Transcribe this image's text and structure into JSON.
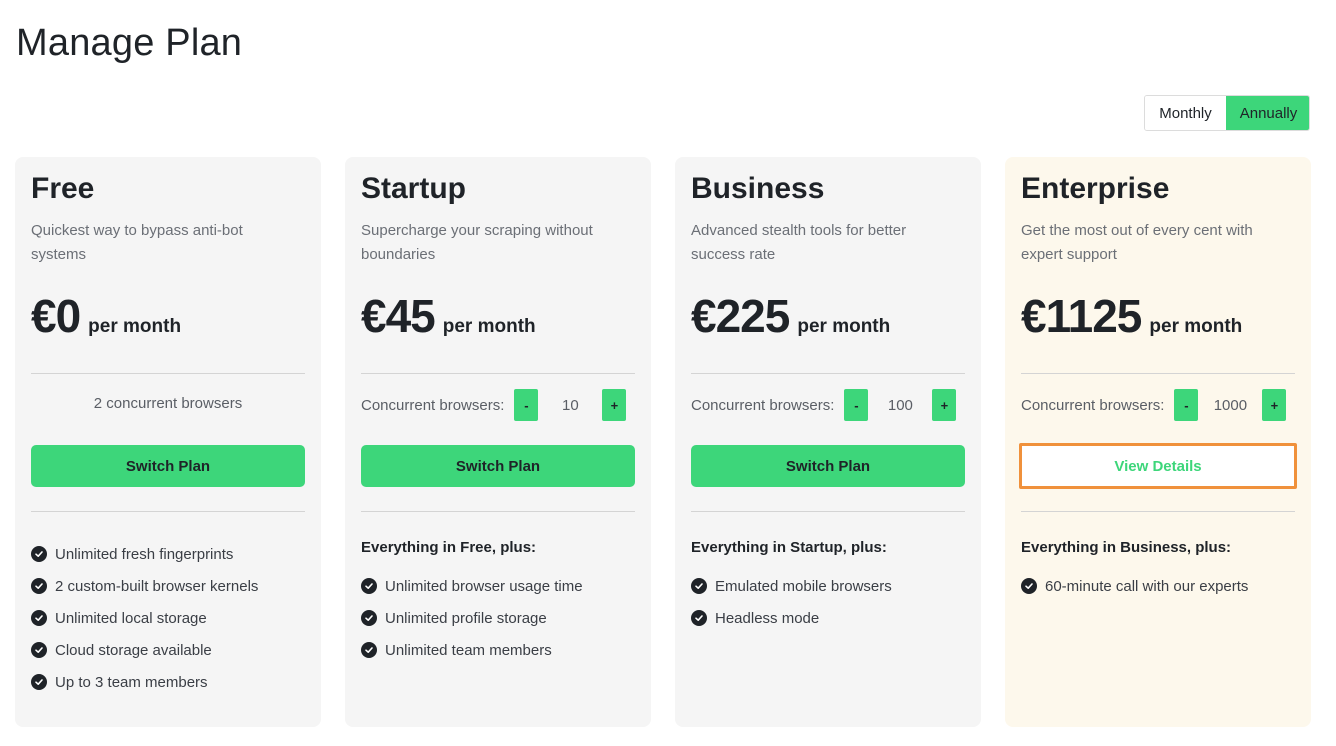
{
  "page_title": "Manage Plan",
  "billing_toggle": {
    "monthly": "Monthly",
    "annually": "Annually",
    "selected": "Annually"
  },
  "colors": {
    "accent": "#3dd67a",
    "highlight_border": "#f0913b",
    "enterprise_bg": "#fdf8ec",
    "card_bg": "#f5f5f5"
  },
  "plans": [
    {
      "name": "Free",
      "description": "Quickest way to bypass anti-bot systems",
      "price": "€0",
      "period": "per month",
      "browsers_text": "2 concurrent browsers",
      "action": "Switch Plan",
      "features": [
        "Unlimited fresh fingerprints",
        "2 custom-built browser kernels",
        "Unlimited local storage",
        "Cloud storage available",
        "Up to 3 team members"
      ]
    },
    {
      "name": "Startup",
      "description": "Supercharge your scraping without boundaries",
      "price": "€45",
      "period": "per month",
      "browsers_label": "Concurrent browsers:",
      "browsers_value": "10",
      "action": "Switch Plan",
      "features_heading": "Everything in Free, plus:",
      "features": [
        "Unlimited browser usage time",
        "Unlimited profile storage",
        "Unlimited team members"
      ]
    },
    {
      "name": "Business",
      "description": "Advanced stealth tools for better success rate",
      "price": "€225",
      "period": "per month",
      "browsers_label": "Concurrent browsers:",
      "browsers_value": "100",
      "action": "Switch Plan",
      "features_heading": "Everything in Startup, plus:",
      "features": [
        "Emulated mobile browsers",
        "Headless mode"
      ]
    },
    {
      "name": "Enterprise",
      "description": "Get the most out of every cent with expert support",
      "price": "€1125",
      "period": "per month",
      "browsers_label": "Concurrent browsers:",
      "browsers_value": "1000",
      "action": "View Details",
      "features_heading": "Everything in Business, plus:",
      "features": [
        "60-minute call with our experts"
      ]
    }
  ],
  "stepper": {
    "minus": "-",
    "plus": "+"
  },
  "icons": {
    "feature": "check-circle-icon"
  }
}
